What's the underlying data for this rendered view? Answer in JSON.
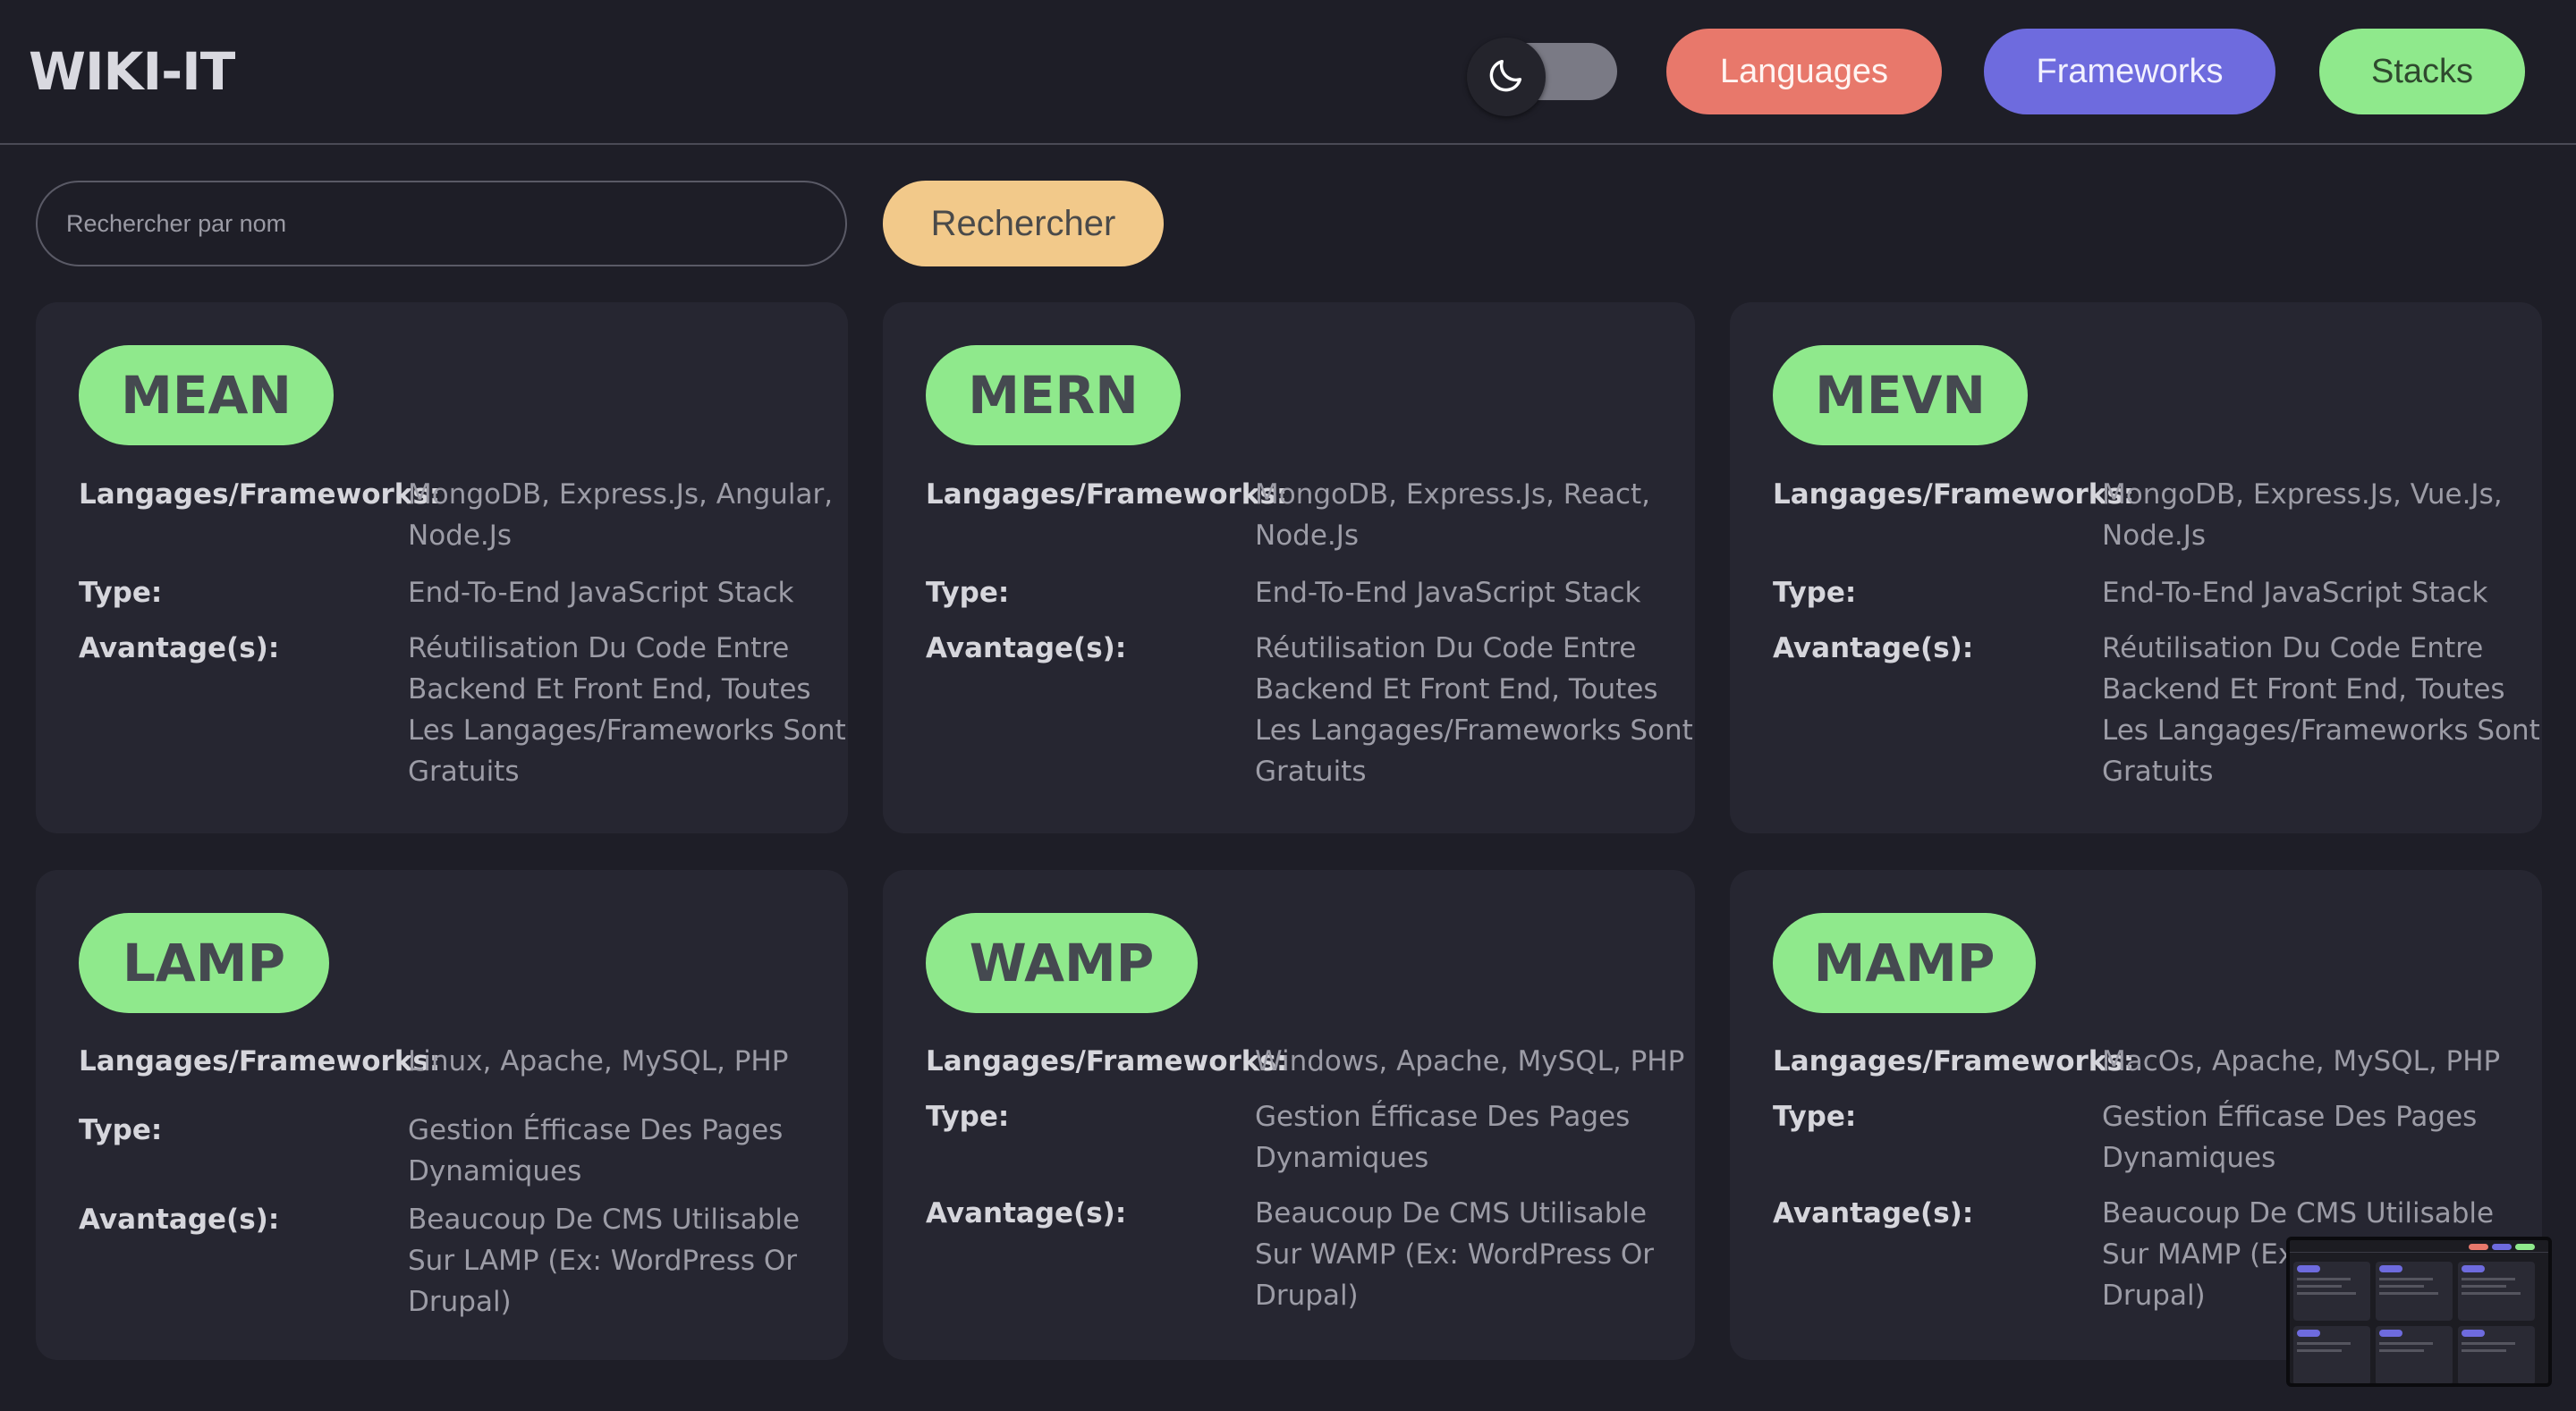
{
  "header": {
    "logo": "WIKI-IT",
    "theme_toggle_icon": "moon-icon",
    "nav": [
      {
        "label": "Languages",
        "color": "#e8786b"
      },
      {
        "label": "Frameworks",
        "color": "#6e6bde"
      },
      {
        "label": "Stacks",
        "color": "#8fe98c"
      }
    ]
  },
  "search": {
    "placeholder": "Rechercher par nom",
    "value": "",
    "button_label": "Rechercher"
  },
  "labels": {
    "frameworks": "Langages/Frameworks:",
    "type": "Type:",
    "advantages": "Avantage(s):"
  },
  "cards": [
    {
      "name": "MEAN",
      "frameworks": "MongoDB, Express.Js, Angular, Node.Js",
      "type": "End-To-End JavaScript Stack",
      "advantages": "Réutilisation Du Code Entre Backend Et Front End, Toutes Les Langages/Frameworks Sont Gratuits"
    },
    {
      "name": "MERN",
      "frameworks": "MongoDB, Express.Js, React, Node.Js",
      "type": "End-To-End JavaScript Stack",
      "advantages": "Réutilisation Du Code Entre Backend Et Front End, Toutes Les Langages/Frameworks Sont Gratuits"
    },
    {
      "name": "MEVN",
      "frameworks": "MongoDB, Express.Js, Vue.Js, Node.Js",
      "type": "End-To-End JavaScript Stack",
      "advantages": "Réutilisation Du Code Entre Backend Et Front End, Toutes Les Langages/Frameworks Sont Gratuits"
    },
    {
      "name": "LAMP",
      "frameworks": "Linux, Apache, MySQL, PHP",
      "type": "Gestion Éfficase Des Pages Dynamiques",
      "advantages": "Beaucoup De CMS Utilisable Sur LAMP (Ex: WordPress Or Drupal)"
    },
    {
      "name": "WAMP",
      "frameworks": "Windows, Apache, MySQL, PHP",
      "type": "Gestion Éfficase Des Pages Dynamiques",
      "advantages": "Beaucoup De CMS Utilisable Sur WAMP (Ex: WordPress Or Drupal)"
    },
    {
      "name": "MAMP",
      "frameworks": "MacOs, Apache, MySQL, PHP",
      "type": "Gestion Éfficase Des Pages Dynamiques",
      "advantages": "Beaucoup De CMS Utilisable Sur MAMP (Ex: WordPress Or Drupal)"
    }
  ]
}
